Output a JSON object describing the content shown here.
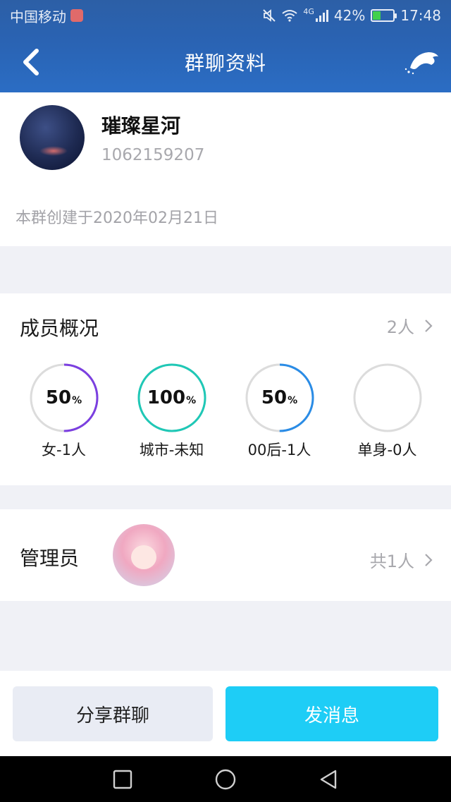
{
  "status_bar": {
    "carrier": "中国移动",
    "network": "4G",
    "battery": "42%",
    "battery_level": 0.42,
    "time": "17:48",
    "icons": [
      "mute-icon",
      "wifi-icon",
      "signal-icon",
      "battery-icon"
    ]
  },
  "header": {
    "title": "群聊资料",
    "back_icon": "chevron-left-icon",
    "right_icon": "dolphin-icon"
  },
  "group": {
    "name": "璀璨星河",
    "id": "1062159207",
    "created": "本群创建于2020年02月21日"
  },
  "members": {
    "title": "成员概况",
    "count": "2人",
    "stats": [
      {
        "value": "50",
        "unit": "%",
        "percent": 50,
        "label": "女-1人",
        "color": "#7b3fe0"
      },
      {
        "value": "100",
        "unit": "%",
        "percent": 100,
        "label": "城市-未知",
        "color": "#1fc8b6"
      },
      {
        "value": "50",
        "unit": "%",
        "percent": 50,
        "label": "00后-1人",
        "color": "#2a8ce6"
      },
      {
        "value": "",
        "unit": "",
        "percent": 0,
        "label": "单身-0人",
        "color": "#dcdcdc"
      }
    ]
  },
  "admins": {
    "title": "管理员",
    "count": "共1人"
  },
  "actions": {
    "share": "分享群聊",
    "send": "发消息"
  },
  "colors": {
    "header_blue": "#2a63b3",
    "accent_cyan": "#1ecdf6",
    "ring_track": "#dcdcdc"
  }
}
